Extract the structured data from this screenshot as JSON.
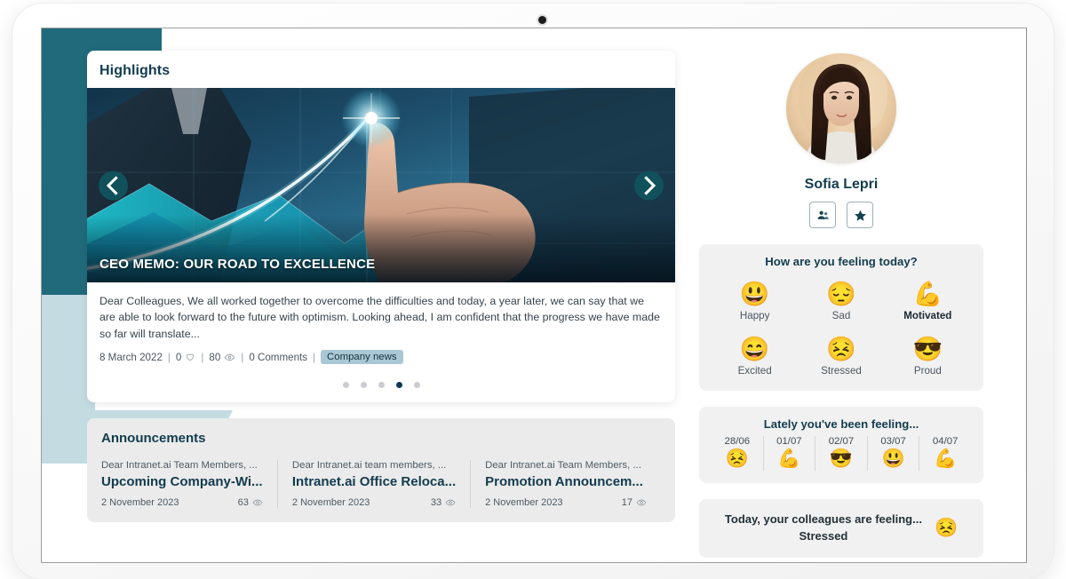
{
  "device": {
    "camera_icon": "camera-dot"
  },
  "highlights": {
    "panel_title": "Highlights",
    "hero_title": "CEO MEMO: OUR ROAD TO EXCELLENCE",
    "prev_icon": "chevron-left-icon",
    "next_icon": "chevron-right-icon",
    "excerpt": "Dear Colleagues, We all worked together to overcome the difficulties and today, a year later, we can say that we are able to look forward to the future with optimism. Looking ahead, I am confident that the progress we have made so far will translate...",
    "meta": {
      "date": "8 March 2022",
      "likes": "0",
      "likes_icon": "heart-icon",
      "views": "80",
      "views_icon": "eye-icon",
      "comments": "0 Comments",
      "tag": "Company news",
      "separator": "|"
    },
    "dots": {
      "count": 5,
      "active_index": 3
    }
  },
  "announcements": {
    "title": "Announcements",
    "items": [
      {
        "preview": "Dear Intranet.ai Team Members, ...",
        "headline": "Upcoming Company-Wi...",
        "date": "2 November 2023",
        "views": "63",
        "views_icon": "eye-icon"
      },
      {
        "preview": "Dear Intranet.ai team members, ...",
        "headline": "Intranet.ai Office Reloca...",
        "date": "2 November 2023",
        "views": "33",
        "views_icon": "eye-icon"
      },
      {
        "preview": "Dear Intranet.ai Team Members, ...",
        "headline": "Promotion Announcem...",
        "date": "2 November 2023",
        "views": "17",
        "views_icon": "eye-icon"
      }
    ]
  },
  "profile": {
    "name": "Sofia Lepri",
    "avatar_alt": "user-avatar",
    "actions": [
      {
        "icon": "people-icon",
        "name": "contacts-button"
      },
      {
        "icon": "star-icon",
        "name": "favorite-button"
      }
    ]
  },
  "mood_today": {
    "title": "How are you feeling today?",
    "options": [
      {
        "label": "Happy",
        "emoji": "😃",
        "selected": false
      },
      {
        "label": "Sad",
        "emoji": "😔",
        "selected": false
      },
      {
        "label": "Motivated",
        "emoji": "💪",
        "selected": true
      },
      {
        "label": "Excited",
        "emoji": "😄",
        "selected": false
      },
      {
        "label": "Stressed",
        "emoji": "😣",
        "selected": false
      },
      {
        "label": "Proud",
        "emoji": "😎",
        "selected": false
      }
    ]
  },
  "mood_history": {
    "title": "Lately you've been feeling...",
    "entries": [
      {
        "date": "28/06",
        "emoji": "😣",
        "mood": "Stressed"
      },
      {
        "date": "01/07",
        "emoji": "💪",
        "mood": "Motivated"
      },
      {
        "date": "02/07",
        "emoji": "😎",
        "mood": "Proud"
      },
      {
        "date": "03/07",
        "emoji": "😃",
        "mood": "Happy"
      },
      {
        "date": "04/07",
        "emoji": "💪",
        "mood": "Motivated"
      }
    ]
  },
  "colleagues_mood": {
    "line1": "Today, your colleagues are feeling...",
    "line2": "Stressed",
    "emoji": "😣"
  },
  "colors": {
    "brand_dark": "#123c4e",
    "teal_deco": "#216a7c",
    "light_deco": "#c4dbe2",
    "accent_dot": "#0d3a52",
    "tag_bg": "#a9c7d4",
    "panel_bg": "#f1f1f1",
    "announcement_bg": "#ebebeb"
  }
}
